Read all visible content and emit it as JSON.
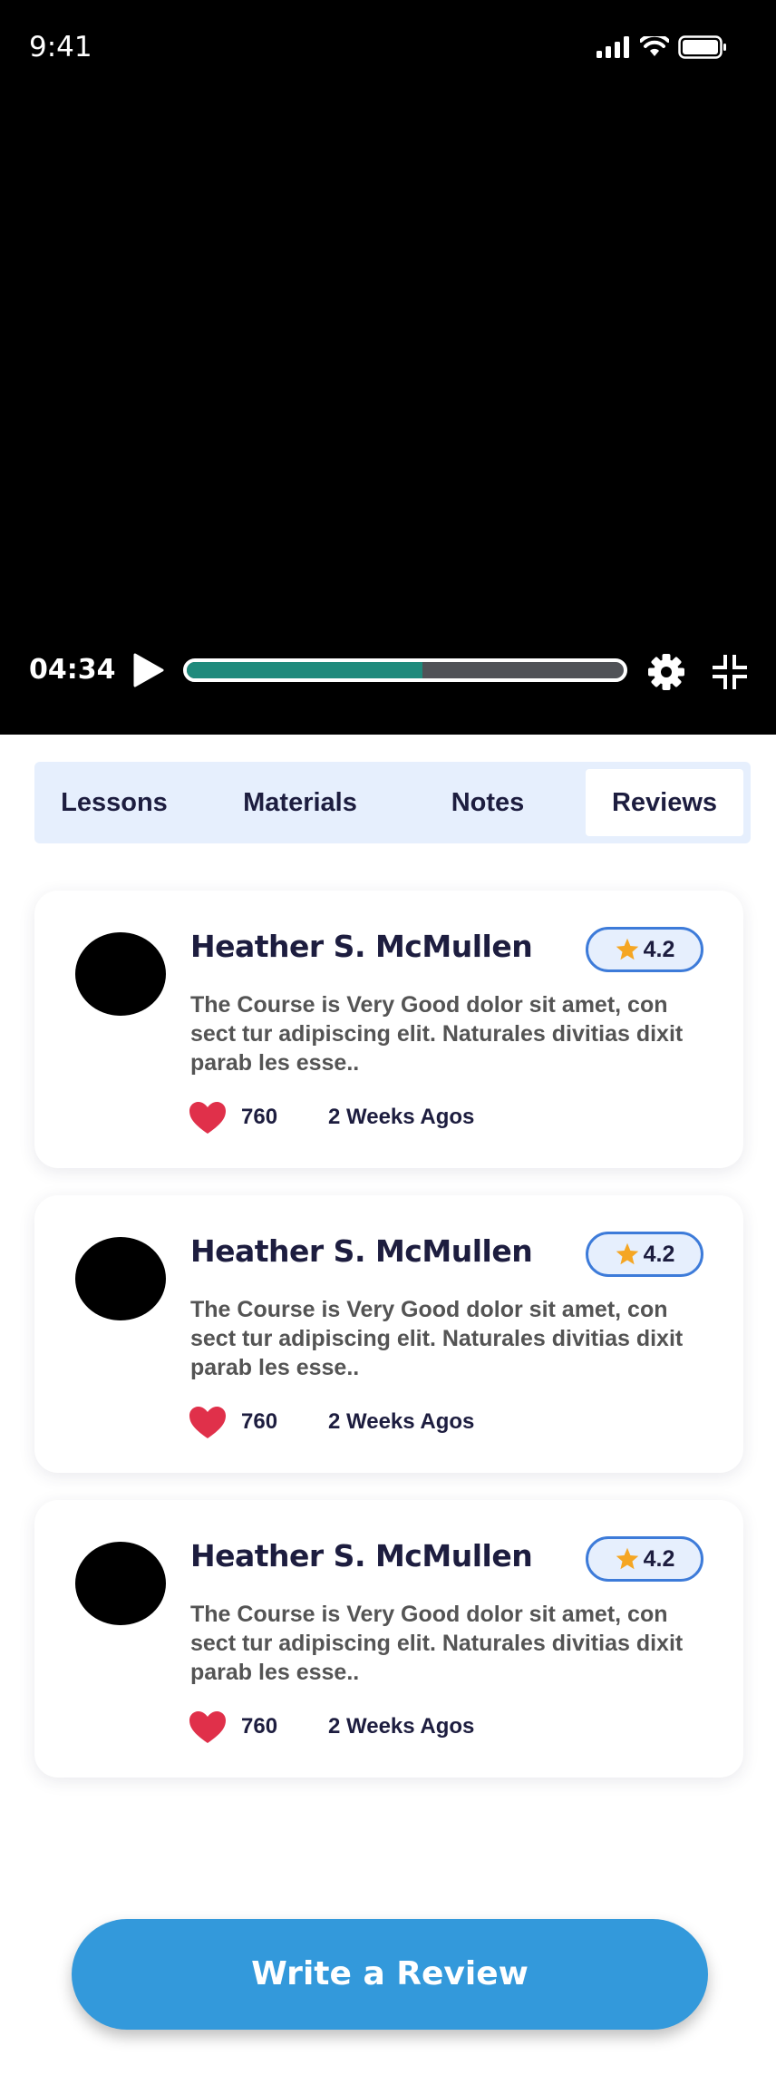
{
  "status_bar": {
    "time": "9:41"
  },
  "player": {
    "elapsed": "04:34",
    "progress_fraction": 0.54
  },
  "tabs": [
    {
      "label": "Lessons",
      "active": false
    },
    {
      "label": "Materials",
      "active": false
    },
    {
      "label": "Notes",
      "active": false
    },
    {
      "label": "Reviews",
      "active": true
    }
  ],
  "reviews": [
    {
      "name": "Heather S. McMullen",
      "rating": "4.2",
      "text": "The Course is Very Good dolor sit amet, con sect tur adipiscing elit. Naturales divitias dixit parab les esse..",
      "likes": "760",
      "ago": "2 Weeks Agos"
    },
    {
      "name": "Heather S. McMullen",
      "rating": "4.2",
      "text": "The Course is Very Good dolor sit amet, con sect tur adipiscing elit. Naturales divitias dixit parab les esse..",
      "likes": "760",
      "ago": "2 Weeks Agos"
    },
    {
      "name": "Heather S. McMullen",
      "rating": "4.2",
      "text": "The Course is Very Good dolor sit amet, con sect tur adipiscing elit. Naturales divitias dixit parab les esse..",
      "likes": "760",
      "ago": "2 Weeks Agos"
    }
  ],
  "write_review_label": "Write a Review",
  "colors": {
    "accent": "#3399db",
    "progress": "#1f8a7c",
    "heart": "#e0304a",
    "star": "#f5a623",
    "tab_bg": "#e6effd"
  },
  "icons": [
    "signal-icon",
    "wifi-icon",
    "battery-icon",
    "play-icon",
    "gear-icon",
    "collapse-icon",
    "star-icon",
    "heart-icon"
  ]
}
